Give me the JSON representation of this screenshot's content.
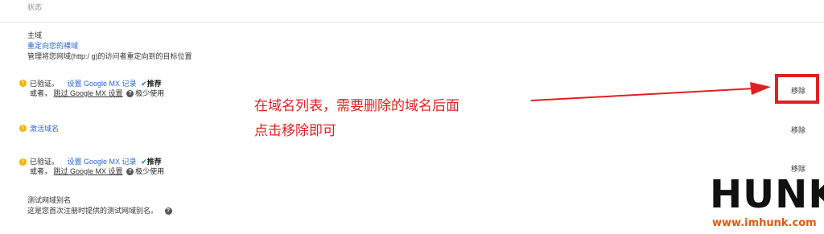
{
  "header": {
    "label": "状态"
  },
  "primary_domain": {
    "title": "主域",
    "redirect_link": "重定向您的裸域",
    "description": "管理将您网域(http:/               g)的访问者重定向到的目标位置"
  },
  "rows": [
    {
      "verified": "已验证。",
      "setup_link": "设置 Google MX 记录",
      "recommended": "推荐",
      "or_text": "或者，",
      "skip_link": "跳过 Google MX 设置",
      "rarely": "极少使用",
      "remove": "移除"
    },
    {
      "activate_link": "激活域名",
      "remove": "移除"
    },
    {
      "verified": "已验证。",
      "setup_link": "设置 Google MX 记录",
      "recommended": "推荐",
      "or_text": "或者，",
      "skip_link": "跳过 Google MX 设置",
      "rarely": "极少使用",
      "remove": "移除"
    }
  ],
  "test_alias": {
    "title": "测试网域别名",
    "description": "这是您首次注册时提供的测试网域别名。"
  },
  "annotation": {
    "line1": "在域名列表，需要删除的域名后面",
    "line2": "点击移除即可"
  },
  "watermark": {
    "brand": "HUNK",
    "url": "www.imhunk.com"
  },
  "colors": {
    "accent_red": "#e02020",
    "link_blue": "#2a66d6",
    "warning_yellow": "#f4b400"
  },
  "icons": [
    "warning-icon",
    "check-icon",
    "help-icon",
    "arrow-icon"
  ]
}
